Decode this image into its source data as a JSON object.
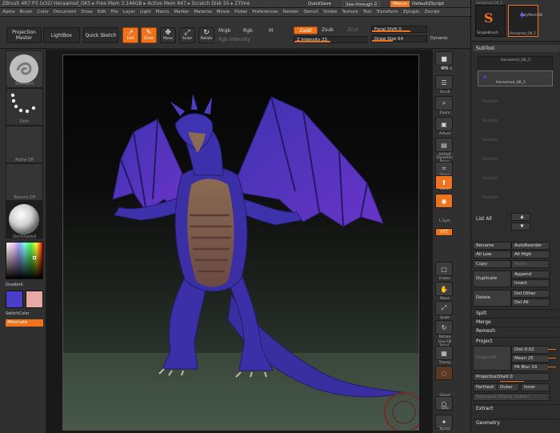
{
  "title_bar": {
    "text": "ZBrush 4R7 P3 (x32)   Heraamsd_OK5   ▸ Free Mem 3.146GB ▸ Active Mem 847 ▸ Scratch Disk 55 ▸ ZTime",
    "quicksave": "QuickSave",
    "see_through": "See-through  0",
    "menus": "Menus",
    "default_zscript": "DefaultZScript"
  },
  "menu_bar": [
    "Alpha",
    "Brush",
    "Color",
    "Document",
    "Draw",
    "Edit",
    "File",
    "Layer",
    "Light",
    "Macro",
    "Marker",
    "Material",
    "Movie",
    "Picker",
    "Preferences",
    "Render",
    "Stencil",
    "Stroke",
    "Texture",
    "Tool",
    "Transform",
    "Zplugin",
    "Zscript"
  ],
  "toolbar": {
    "projection_master": "Projection Master",
    "lightbox": "LightBox",
    "quick_sketch": "Quick Sketch",
    "edit": "Edit",
    "draw": "Draw",
    "move": "Move",
    "scale": "Scale",
    "rotate": "Rotate",
    "mrgb": "Mrgb",
    "rgb": "Rgb",
    "m": "M",
    "rgb_intensity": "Rgb Intensity",
    "zadd": "Zadd",
    "zsub": "Zsub",
    "zcut": "Zcut",
    "z_intensity": "Z Intensity 25",
    "focal_shift": "Focal Shift 0",
    "draw_size": "Draw Size 64",
    "dynamic": "Dynamic"
  },
  "left_shelf": {
    "brush_label": "Standard",
    "stroke_label": "Dots",
    "alpha_label": "Alpha Off",
    "texture_label": "Texture Off",
    "material_label": "SkinShade4",
    "gradient_label": "Gradient",
    "switchcolor_label": "SwitchColor",
    "alternate_label": "Alternate"
  },
  "right_shelf": {
    "bpr": "BPR",
    "spix": "SPix 3",
    "scroll": "Scroll",
    "zoom": "Zoom",
    "actual": "Actual",
    "aahalf": "AAHalf",
    "dynamic_persp": "Dynamic Persp",
    "floor": "Floor",
    "local": "Local",
    "lsym": "L.Sym",
    "xyz": "XYZ",
    "frame": "Frame",
    "move": "Move",
    "scale": "Scale",
    "rotate": "Rotate",
    "line_fill": "Line Fill PolyF",
    "transp": "Transp",
    "ghost": "Ghost",
    "solo": "Solo",
    "xpose": "Xpose"
  },
  "right_panel": {
    "tools": {
      "single_brush": "SingleBrush",
      "active_tool": "Heraamsd_OK_5",
      "top_left": "Heraamsd_OK_5",
      "polymesh": "PolyMesh3D"
    },
    "subtool_header": "SubTool",
    "subtool_item_1": "Heraamsd_OK_5",
    "subtool_item_2": "Heraamsd_OK_5",
    "empty_slot": "Subtool",
    "list_all": "List All",
    "rename": "Rename",
    "auto_reorder": "AutoReorder",
    "all_low": "All Low",
    "all_high": "All High",
    "copy": "Copy",
    "paste": "Paste",
    "duplicate": "Duplicate",
    "append": "Append",
    "insert": "Insert",
    "delete": "Delete",
    "del_other": "Del Other",
    "del_all": "Del All",
    "split": "Split",
    "merge": "Merge",
    "remesh": "Remesh",
    "project": "Project",
    "project_all": "ProjectAll",
    "dist": "Dist 0.02",
    "mean": "Mean 25",
    "pa_blur": "PA Blur 10",
    "projection_shell": "ProjectionShell 0",
    "farthest": "Farthest",
    "outer": "Outer",
    "inner": "Inner",
    "reproject_higher": "Reproject Higher Subdiv",
    "extract": "Extract",
    "geometry": "Geometry"
  },
  "colors": {
    "accent": "#f0731c",
    "main_color": "#4a3fc8",
    "secondary_color": "#e8a8a4",
    "dragon_body": "#3d2fa6",
    "dragon_belly": "#8c6a4e"
  }
}
